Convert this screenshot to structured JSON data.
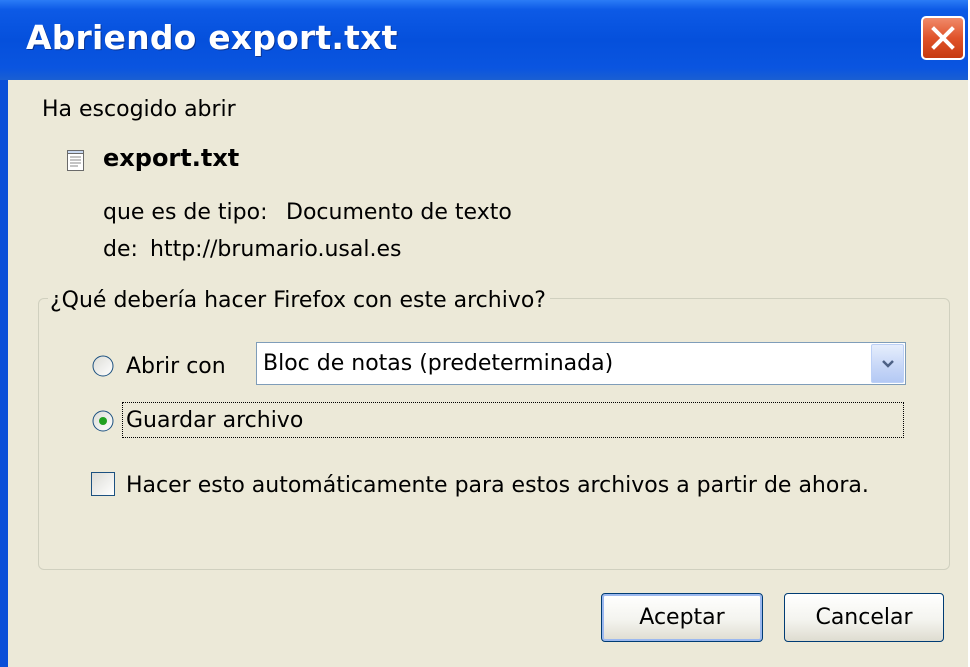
{
  "dialog": {
    "title": "Abriendo export.txt"
  },
  "intro": "Ha escogido abrir",
  "file": {
    "name": "export.txt",
    "type_label": "que es de tipo:",
    "type_value": "Documento de texto",
    "from_label": "de:",
    "from_value": "http://brumario.usal.es"
  },
  "action_group": {
    "legend": "¿Qué debería hacer Firefox con este archivo?",
    "open_with": {
      "label": "Abrir con",
      "selected": false,
      "app_value": "Bloc de notas (predeterminada)"
    },
    "save_file": {
      "label": "Guardar archivo",
      "selected": true
    },
    "auto_checkbox": {
      "label": "Hacer esto automáticamente para estos archivos a partir de ahora.",
      "checked": false
    }
  },
  "buttons": {
    "accept": "Aceptar",
    "cancel": "Cancelar"
  },
  "colors": {
    "titlebar": "#0550dc",
    "client_bg": "#ece9d8",
    "close_button": "#e0532a"
  },
  "icons": [
    "close-icon",
    "text-file-icon",
    "chevron-down-icon"
  ]
}
